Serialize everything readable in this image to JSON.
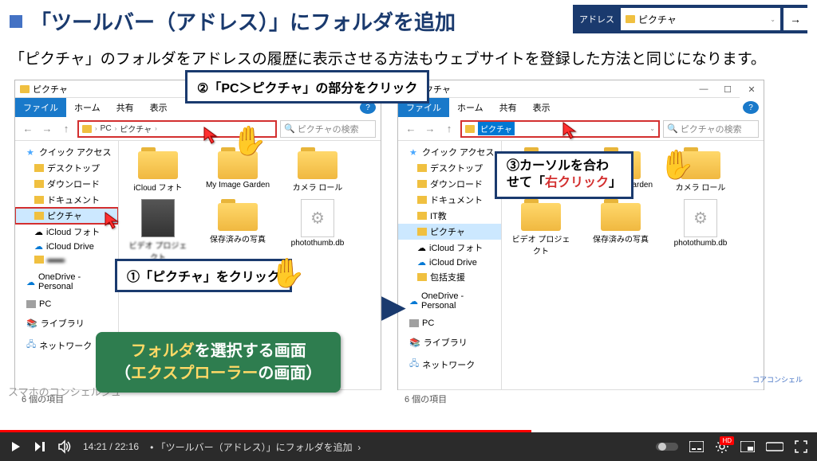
{
  "header": {
    "title": "「ツールバー（アドレス）」にフォルダを追加"
  },
  "toolbar": {
    "label": "アドレス",
    "value": "ピクチャ",
    "arrow": "→"
  },
  "subtitle": "「ピクチャ」のフォルダをアドレスの履歴に表示させる方法もウェブサイトを登録した方法と同じになります。",
  "explorer": {
    "title": "ピクチャ",
    "tabs": {
      "file": "ファイル",
      "home": "ホーム",
      "share": "共有",
      "view": "表示"
    },
    "nav": {
      "back": "←",
      "fwd": "→",
      "up": "↑"
    },
    "breadcrumb": {
      "pc": "PC",
      "sep": "›",
      "pictures": "ピクチャ"
    },
    "addr_typed": "ピクチャ",
    "search_ph": "ピクチャの検索",
    "sidebar": {
      "quick": "クイック アクセス",
      "desktop": "デスクトップ",
      "downloads": "ダウンロード",
      "documents": "ドキュメント",
      "it": "IT教",
      "pictures": "ピクチャ",
      "icloud_photo": "iCloud フォト",
      "icloud_drive": "iCloud Drive",
      "support": "包括支援",
      "onedrive": "OneDrive - Personal",
      "pc": "PC",
      "library": "ライブラリ",
      "network": "ネットワーク"
    },
    "items": {
      "icloud": "iCloud フォト",
      "myimage": "My Image Garden",
      "camera": "カメラ ロール",
      "video_proj": "ビデオ プロジェクト",
      "saved": "保存済みの写真",
      "photothumb": "photothumb.db"
    },
    "status": "6 個の項目"
  },
  "callouts": {
    "c1": "①「ピクチャ」をクリック",
    "c2": "②「PC＞ピクチャ」の部分をクリック",
    "c3a": "③カーソルを合わ",
    "c3b": "せて「",
    "c3c": "右クリック",
    "c3d": "」"
  },
  "banner": {
    "l1a": "フォルダ",
    "l1b": "を選択する画面",
    "l2a": "（",
    "l2b": "エクスプローラー",
    "l2c": "の画面）"
  },
  "logo": "コアコンシェル",
  "watermark": "スマホのコンシェルジュ",
  "video": {
    "time": "14:21 / 22:16",
    "chapter": "「ツールバー（アドレス）」にフォルダを追加",
    "hd": "HD"
  }
}
